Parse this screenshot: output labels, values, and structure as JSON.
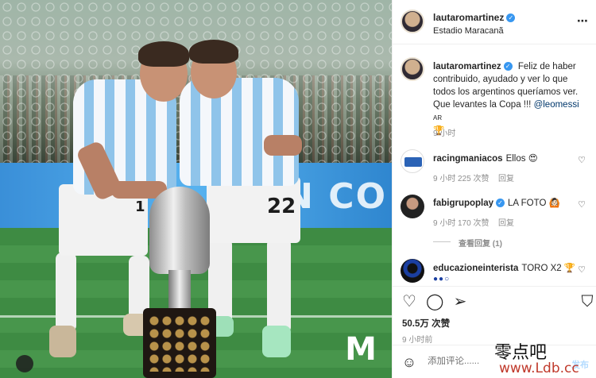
{
  "post": {
    "author": "lautaromartinez",
    "location": "Estadio Maracanã",
    "caption": "Feliz de haber contribuido, ayudado y ver lo que todos los argentinos queríamos ver. Que levantes la Copa !!! ",
    "caption_mention": "@leomessi",
    "caption_tail": " 🏆",
    "ar_tag": "AR",
    "time": "9 小时"
  },
  "photo": {
    "board_text": "IÓN CO",
    "numbers": [
      "22",
      "1"
    ],
    "watermark_logo": "M"
  },
  "comments": [
    {
      "user": "racingmaniacos",
      "text": "Ellos 😍",
      "time": "9 小时",
      "likes": "225 次赞",
      "reply": "回复"
    },
    {
      "user": "fabigrupoplay",
      "verified": true,
      "text": "LA FOTO 🙆🏻",
      "time": "9 小时",
      "likes": "170 次赞",
      "reply": "回复",
      "view_replies": "查看回复 (1)"
    },
    {
      "user": "educazioneinterista",
      "text": "TORO X2 🏆",
      "badge": "●●○"
    }
  ],
  "stats": {
    "likes": "50.5万 次赞",
    "time": "9 小时前"
  },
  "comment_box": {
    "placeholder": "添加评论......",
    "post_label": "发布"
  },
  "watermark": {
    "site_cn": "零点吧",
    "site_url": "www.Ldb.cc"
  },
  "icons": {
    "heart": "heart-icon",
    "comment": "comment-icon",
    "share": "share-icon",
    "save": "bookmark-icon",
    "emoji": "emoji-icon"
  }
}
